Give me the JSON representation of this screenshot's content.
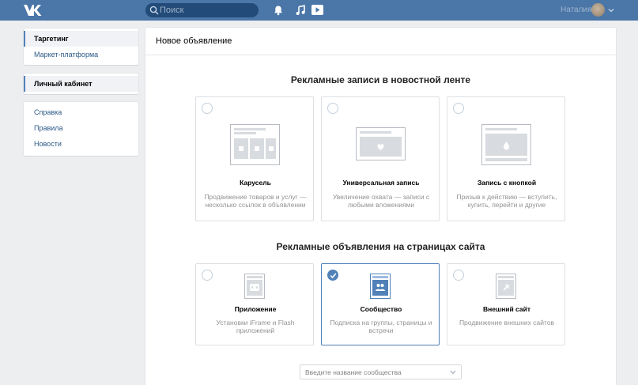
{
  "header": {
    "search_placeholder": "Поиск",
    "user_name": "Наталия"
  },
  "sidebar": {
    "group1": [
      {
        "label": "Таргетинг",
        "active": true
      },
      {
        "label": "Маркет-платформа",
        "active": false
      }
    ],
    "group2": [
      {
        "label": "Личный кабинет",
        "active": true
      }
    ],
    "group3": [
      {
        "label": "Справка",
        "active": false
      },
      {
        "label": "Правила",
        "active": false
      },
      {
        "label": "Новости",
        "active": false
      }
    ]
  },
  "main": {
    "title": "Новое объявление",
    "section1": {
      "title": "Рекламные записи в новостной ленте",
      "cards": [
        {
          "title": "Карусель",
          "desc": "Продвижение товаров и услуг — несколько ссылок в объявлении",
          "icon": "carousel-illustration",
          "selected": false
        },
        {
          "title": "Универсальная запись",
          "desc": "Увеличение охвата — записи с любыми вложениями",
          "icon": "universal-post-illustration",
          "selected": false
        },
        {
          "title": "Запись с кнопкой",
          "desc": "Призыв к действию — вступить, купить, перейти и другие",
          "icon": "button-post-illustration",
          "selected": false
        }
      ]
    },
    "section2": {
      "title": "Рекламные объявления на страницах сайта",
      "cards": [
        {
          "title": "Приложение",
          "desc": "Установки iFrame и Flash приложений",
          "icon": "app-icon",
          "selected": false
        },
        {
          "title": "Сообщество",
          "desc": "Подписка на группы, страницы и встречи",
          "icon": "community-icon",
          "selected": true
        },
        {
          "title": "Внешний сайт",
          "desc": "Продвижение внешних сайтов",
          "icon": "external-site-icon",
          "selected": false
        }
      ]
    },
    "community_select": {
      "placeholder": "Введите название сообщества"
    }
  },
  "colors": {
    "header": "#4a76a8",
    "accent": "#5181b8",
    "link": "#2a5885",
    "background": "#edeef0"
  }
}
